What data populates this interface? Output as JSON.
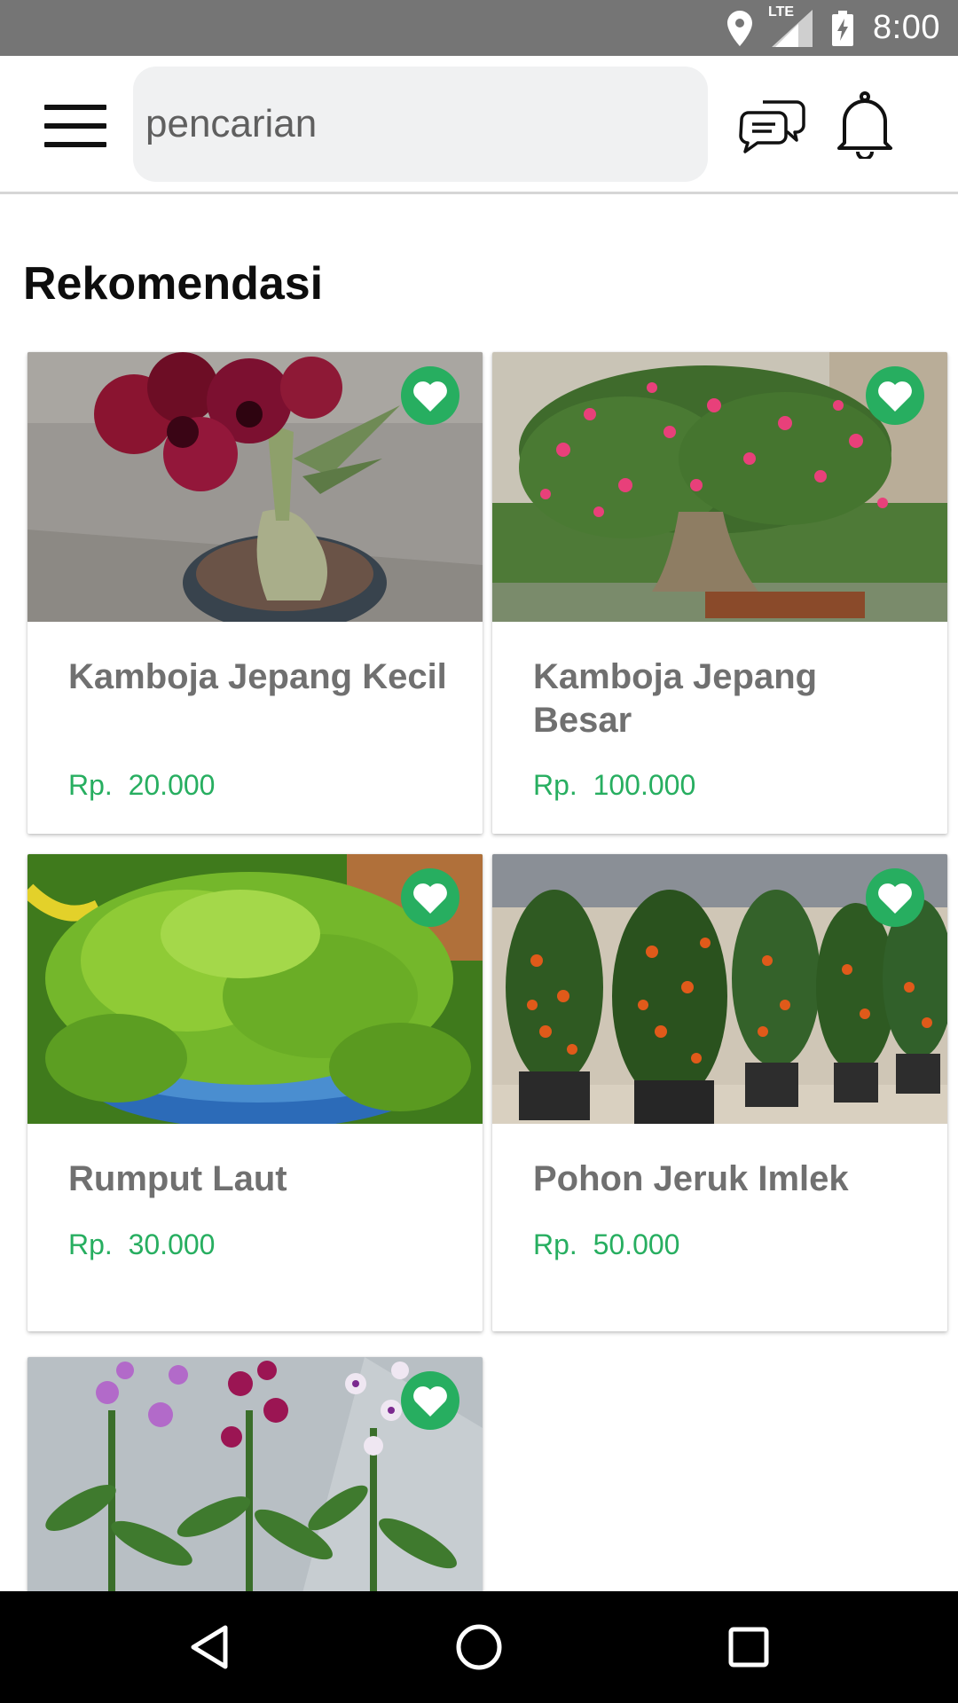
{
  "status_bar": {
    "time": "8:00",
    "network_label": "LTE",
    "icons": [
      "location-icon",
      "signal-icon",
      "battery-charging-icon"
    ]
  },
  "app_bar": {
    "menu_icon": "hamburger-menu-icon",
    "search_placeholder": "pencarian",
    "chat_icon": "chat-bubbles-icon",
    "notification_icon": "bell-icon"
  },
  "section_title": "Rekomendasi",
  "products": [
    {
      "name": "Kamboja Jepang Kecil",
      "price": "Rp.  20.000",
      "favorite_icon": "heart-icon",
      "image": "red-adenium-in-pot"
    },
    {
      "name": "Kamboja Jepang Besar",
      "price": "Rp.  100.000",
      "favorite_icon": "heart-icon",
      "image": "pink-adenium-bonsai"
    },
    {
      "name": "Rumput Laut",
      "price": "Rp.  30.000",
      "favorite_icon": "heart-icon",
      "image": "green-seaweed-in-blue-pot"
    },
    {
      "name": "Pohon Jeruk Imlek",
      "price": "Rp.  50.000",
      "favorite_icon": "heart-icon",
      "image": "potted-orange-trees"
    },
    {
      "name": "",
      "price": "",
      "favorite_icon": "heart-icon",
      "image": "purple-orchids"
    }
  ],
  "nav_bar": {
    "back_icon": "back-triangle-icon",
    "home_icon": "home-circle-icon",
    "recents_icon": "recents-square-icon"
  },
  "colors": {
    "status_bar": "#757575",
    "accent_green": "#27ae60",
    "search_bg": "#f0f1f2",
    "product_name": "#707070",
    "nav_bar": "#000000"
  }
}
